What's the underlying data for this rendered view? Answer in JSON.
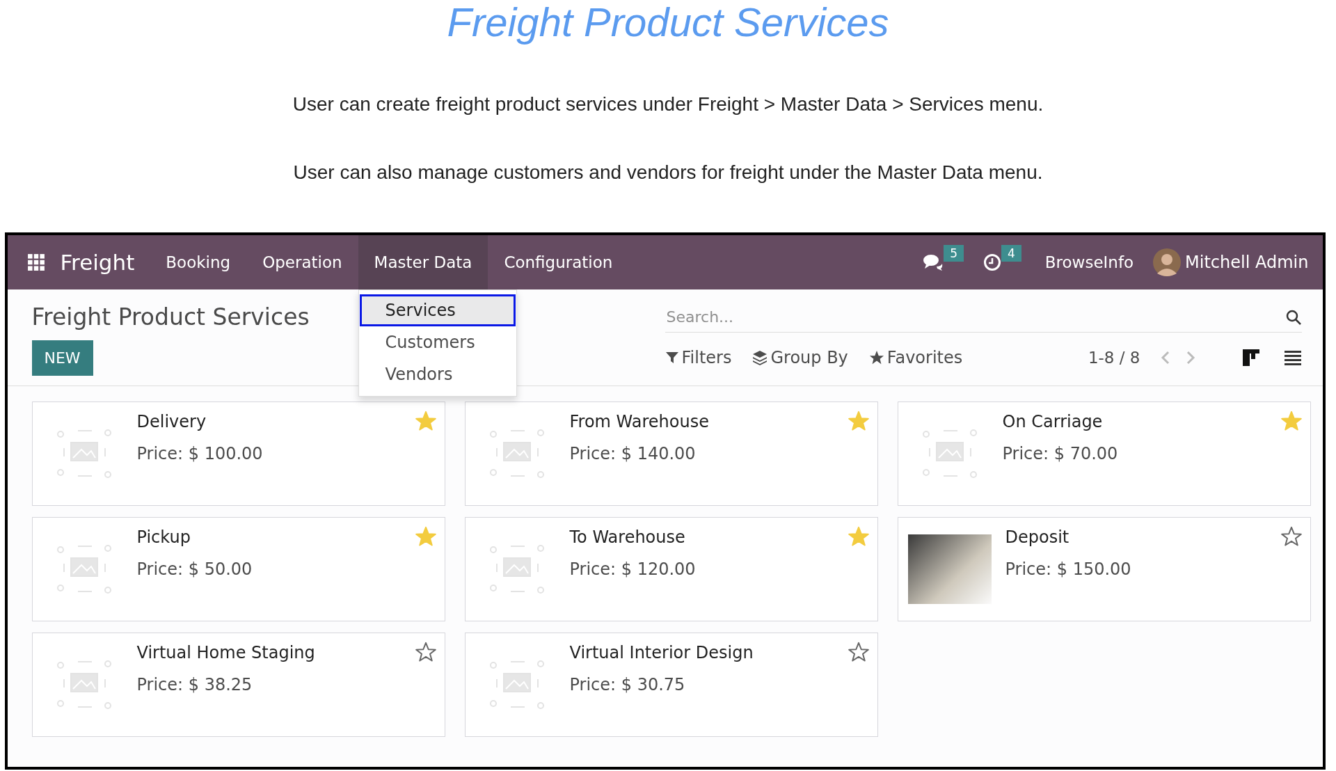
{
  "page": {
    "heading": "Freight Product Services",
    "paragraphs": [
      "User can create freight product services under Freight > Master Data > Services menu.",
      "User can also manage customers and vendors for freight under the Master Data menu."
    ]
  },
  "navbar": {
    "app_name": "Freight",
    "menu": [
      {
        "label": "Booking",
        "selected": false
      },
      {
        "label": "Operation",
        "selected": false
      },
      {
        "label": "Master Data",
        "selected": true
      },
      {
        "label": "Configuration",
        "selected": false
      }
    ],
    "messages_badge": "5",
    "activities_badge": "4",
    "company": "BrowseInfo",
    "user": "Mitchell Admin"
  },
  "dropdown": {
    "items": [
      {
        "label": "Services",
        "selected": true
      },
      {
        "label": "Customers",
        "selected": false
      },
      {
        "label": "Vendors",
        "selected": false
      }
    ]
  },
  "control_panel": {
    "title": "Freight Product Services",
    "new_button": "NEW",
    "search": {
      "placeholder": "Search..."
    },
    "filters": "Filters",
    "group_by": "Group By",
    "favorites": "Favorites",
    "pager": "1-8 / 8"
  },
  "cards": [
    {
      "name": "Delivery",
      "price": "Price: $ 100.00",
      "favorite": true,
      "kind": "placeholder"
    },
    {
      "name": "From Warehouse",
      "price": "Price: $ 140.00",
      "favorite": true,
      "kind": "placeholder"
    },
    {
      "name": "On Carriage",
      "price": "Price: $ 70.00",
      "favorite": true,
      "kind": "placeholder"
    },
    {
      "name": "Pickup",
      "price": "Price: $ 50.00",
      "favorite": true,
      "kind": "placeholder"
    },
    {
      "name": "To Warehouse",
      "price": "Price: $ 120.00",
      "favorite": true,
      "kind": "placeholder"
    },
    {
      "name": "Deposit",
      "price": "Price: $ 150.00",
      "favorite": false,
      "kind": "photo"
    },
    {
      "name": "Virtual Home Staging",
      "price": "Price: $ 38.25",
      "favorite": false,
      "kind": "placeholder"
    },
    {
      "name": "Virtual Interior Design",
      "price": "Price: $ 30.75",
      "favorite": false,
      "kind": "placeholder"
    }
  ]
}
